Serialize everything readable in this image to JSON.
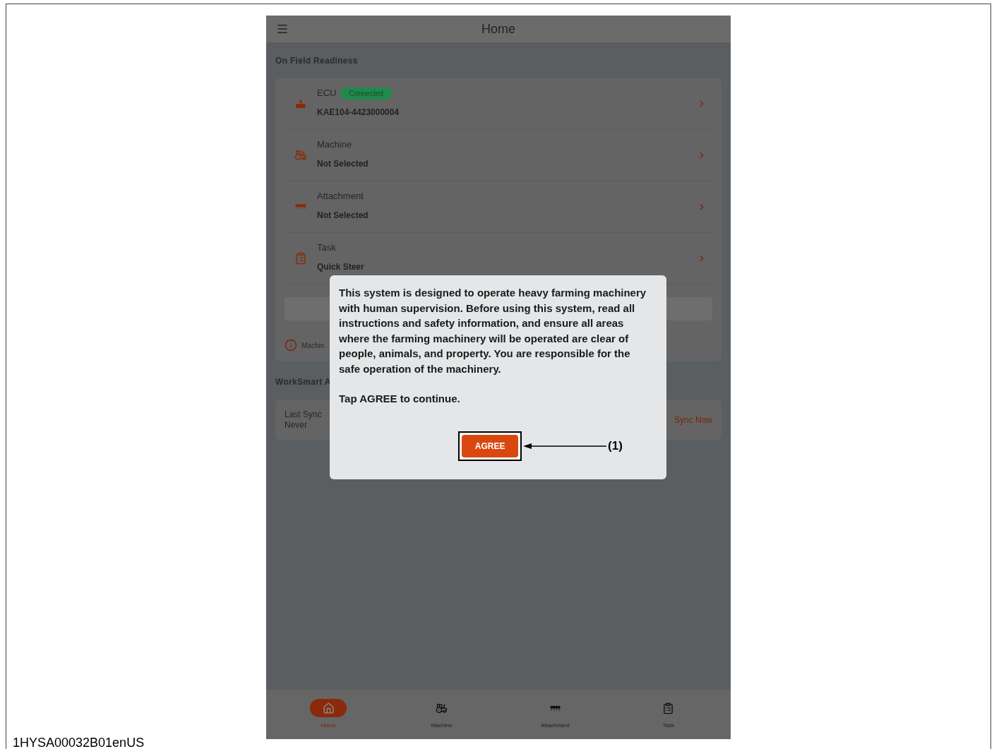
{
  "app_bar": {
    "title": "Home"
  },
  "readiness": {
    "heading": "On Field Readiness",
    "items": [
      {
        "kind": "ecu",
        "label": "ECU",
        "badge": "Connected",
        "value": "KAE104-4423000004"
      },
      {
        "kind": "machine",
        "label": "Machine",
        "value": "Not Selected"
      },
      {
        "kind": "attachment",
        "label": "Attachment",
        "value": "Not Selected"
      },
      {
        "kind": "task",
        "label": "Task",
        "value": "Quick Steer"
      }
    ],
    "note": "Machin"
  },
  "worksmart": {
    "heading": "WorkSmart A",
    "last_sync_label": "Last Sync",
    "last_sync_value": "Never",
    "sync_button": "Sync Now"
  },
  "dialog": {
    "message": "This system is designed to operate heavy farming machinery with human supervision. Before using this system, read all instructions and safety information, and ensure all areas where the farming machinery will be operated are clear of people, animals, and property. You are responsible for the safe operation of the machinery.",
    "prompt": "Tap AGREE to continue.",
    "button": "AGREE",
    "callout": "(1)"
  },
  "bottom_nav": [
    {
      "kind": "home",
      "label": "Home",
      "selected": true
    },
    {
      "kind": "machine",
      "label": "Machine",
      "selected": false
    },
    {
      "kind": "attachment",
      "label": "Attachment",
      "selected": false
    },
    {
      "kind": "task",
      "label": "Task",
      "selected": false
    }
  ],
  "figure_id": "1HYSA00032B01enUS"
}
